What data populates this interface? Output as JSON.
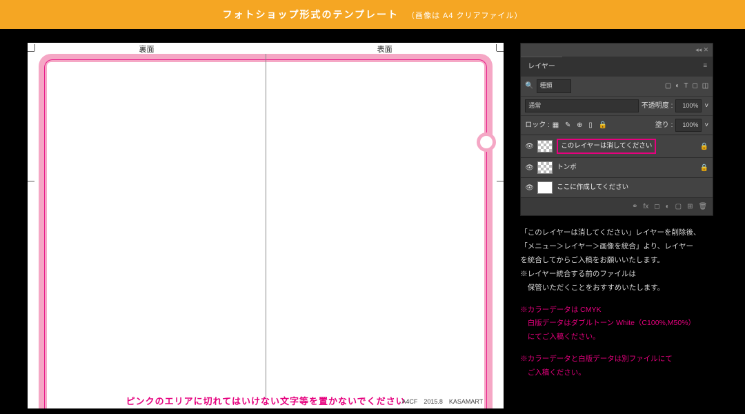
{
  "banner": {
    "main": "フォトショップ形式のテンプレート",
    "sub": "（画像は A4 クリアファイル）"
  },
  "template": {
    "label_back": "裏面",
    "label_front": "表面",
    "footer_warning": "ピンクのエリアに切れてはいけない文字等を置かないでください",
    "footer_meta": "A4CF　2015.8　KASAMART"
  },
  "panel": {
    "tab": "レイヤー",
    "search_label": "種類",
    "blend_mode": "通常",
    "opacity_label": "不透明度 :",
    "opacity_value": "100%",
    "lock_label": "ロック :",
    "fill_label": "塗り :",
    "fill_value": "100%",
    "layers": [
      {
        "name": "このレイヤーは消してください",
        "highlighted": true,
        "locked": true,
        "checker": true
      },
      {
        "name": "トンボ",
        "highlighted": false,
        "locked": true,
        "checker": true
      },
      {
        "name": "ここに作成してください",
        "highlighted": false,
        "locked": false,
        "checker": false
      }
    ]
  },
  "instructions": {
    "lines": [
      "「このレイヤーは消してください」レイヤーを削除後、",
      "「メニュー＞レイヤー＞画像を統合」より、レイヤー",
      "を統合してからご入稿をお願いいたします。",
      "※レイヤー統合する前のファイルは",
      "　保管いただくことをおすすめいたします。"
    ],
    "pink1": [
      "※カラーデータは CMYK",
      "白版データはダブルトーン White（C100%,M50%）",
      "にてご入稿ください。"
    ],
    "pink2": [
      "※カラーデータと白版データは別ファイルにて",
      "ご入稿ください。"
    ]
  }
}
